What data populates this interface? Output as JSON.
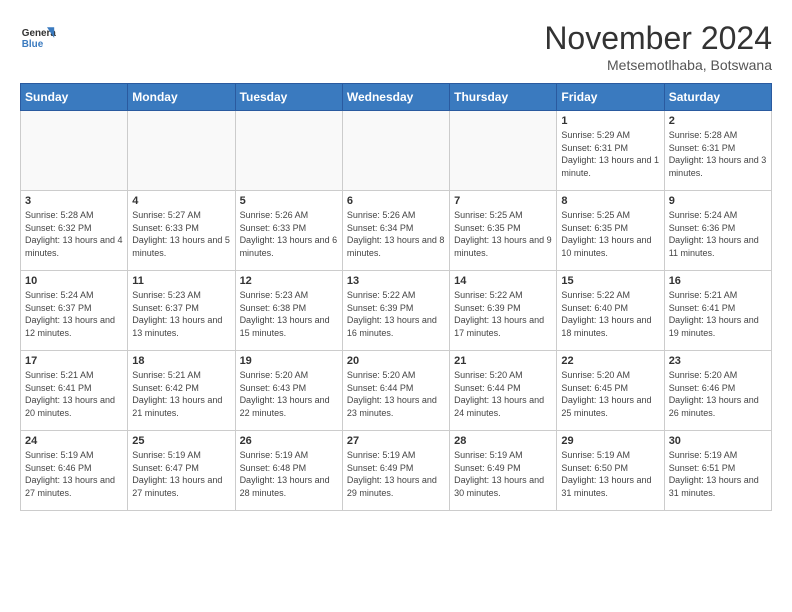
{
  "header": {
    "logo_line1": "General",
    "logo_line2": "Blue",
    "month_title": "November 2024",
    "location": "Metsemotlhaba, Botswana"
  },
  "weekdays": [
    "Sunday",
    "Monday",
    "Tuesday",
    "Wednesday",
    "Thursday",
    "Friday",
    "Saturday"
  ],
  "weeks": [
    [
      {
        "day": "",
        "info": ""
      },
      {
        "day": "",
        "info": ""
      },
      {
        "day": "",
        "info": ""
      },
      {
        "day": "",
        "info": ""
      },
      {
        "day": "",
        "info": ""
      },
      {
        "day": "1",
        "info": "Sunrise: 5:29 AM\nSunset: 6:31 PM\nDaylight: 13 hours and 1 minute."
      },
      {
        "day": "2",
        "info": "Sunrise: 5:28 AM\nSunset: 6:31 PM\nDaylight: 13 hours and 3 minutes."
      }
    ],
    [
      {
        "day": "3",
        "info": "Sunrise: 5:28 AM\nSunset: 6:32 PM\nDaylight: 13 hours and 4 minutes."
      },
      {
        "day": "4",
        "info": "Sunrise: 5:27 AM\nSunset: 6:33 PM\nDaylight: 13 hours and 5 minutes."
      },
      {
        "day": "5",
        "info": "Sunrise: 5:26 AM\nSunset: 6:33 PM\nDaylight: 13 hours and 6 minutes."
      },
      {
        "day": "6",
        "info": "Sunrise: 5:26 AM\nSunset: 6:34 PM\nDaylight: 13 hours and 8 minutes."
      },
      {
        "day": "7",
        "info": "Sunrise: 5:25 AM\nSunset: 6:35 PM\nDaylight: 13 hours and 9 minutes."
      },
      {
        "day": "8",
        "info": "Sunrise: 5:25 AM\nSunset: 6:35 PM\nDaylight: 13 hours and 10 minutes."
      },
      {
        "day": "9",
        "info": "Sunrise: 5:24 AM\nSunset: 6:36 PM\nDaylight: 13 hours and 11 minutes."
      }
    ],
    [
      {
        "day": "10",
        "info": "Sunrise: 5:24 AM\nSunset: 6:37 PM\nDaylight: 13 hours and 12 minutes."
      },
      {
        "day": "11",
        "info": "Sunrise: 5:23 AM\nSunset: 6:37 PM\nDaylight: 13 hours and 13 minutes."
      },
      {
        "day": "12",
        "info": "Sunrise: 5:23 AM\nSunset: 6:38 PM\nDaylight: 13 hours and 15 minutes."
      },
      {
        "day": "13",
        "info": "Sunrise: 5:22 AM\nSunset: 6:39 PM\nDaylight: 13 hours and 16 minutes."
      },
      {
        "day": "14",
        "info": "Sunrise: 5:22 AM\nSunset: 6:39 PM\nDaylight: 13 hours and 17 minutes."
      },
      {
        "day": "15",
        "info": "Sunrise: 5:22 AM\nSunset: 6:40 PM\nDaylight: 13 hours and 18 minutes."
      },
      {
        "day": "16",
        "info": "Sunrise: 5:21 AM\nSunset: 6:41 PM\nDaylight: 13 hours and 19 minutes."
      }
    ],
    [
      {
        "day": "17",
        "info": "Sunrise: 5:21 AM\nSunset: 6:41 PM\nDaylight: 13 hours and 20 minutes."
      },
      {
        "day": "18",
        "info": "Sunrise: 5:21 AM\nSunset: 6:42 PM\nDaylight: 13 hours and 21 minutes."
      },
      {
        "day": "19",
        "info": "Sunrise: 5:20 AM\nSunset: 6:43 PM\nDaylight: 13 hours and 22 minutes."
      },
      {
        "day": "20",
        "info": "Sunrise: 5:20 AM\nSunset: 6:44 PM\nDaylight: 13 hours and 23 minutes."
      },
      {
        "day": "21",
        "info": "Sunrise: 5:20 AM\nSunset: 6:44 PM\nDaylight: 13 hours and 24 minutes."
      },
      {
        "day": "22",
        "info": "Sunrise: 5:20 AM\nSunset: 6:45 PM\nDaylight: 13 hours and 25 minutes."
      },
      {
        "day": "23",
        "info": "Sunrise: 5:20 AM\nSunset: 6:46 PM\nDaylight: 13 hours and 26 minutes."
      }
    ],
    [
      {
        "day": "24",
        "info": "Sunrise: 5:19 AM\nSunset: 6:46 PM\nDaylight: 13 hours and 27 minutes."
      },
      {
        "day": "25",
        "info": "Sunrise: 5:19 AM\nSunset: 6:47 PM\nDaylight: 13 hours and 27 minutes."
      },
      {
        "day": "26",
        "info": "Sunrise: 5:19 AM\nSunset: 6:48 PM\nDaylight: 13 hours and 28 minutes."
      },
      {
        "day": "27",
        "info": "Sunrise: 5:19 AM\nSunset: 6:49 PM\nDaylight: 13 hours and 29 minutes."
      },
      {
        "day": "28",
        "info": "Sunrise: 5:19 AM\nSunset: 6:49 PM\nDaylight: 13 hours and 30 minutes."
      },
      {
        "day": "29",
        "info": "Sunrise: 5:19 AM\nSunset: 6:50 PM\nDaylight: 13 hours and 31 minutes."
      },
      {
        "day": "30",
        "info": "Sunrise: 5:19 AM\nSunset: 6:51 PM\nDaylight: 13 hours and 31 minutes."
      }
    ]
  ]
}
